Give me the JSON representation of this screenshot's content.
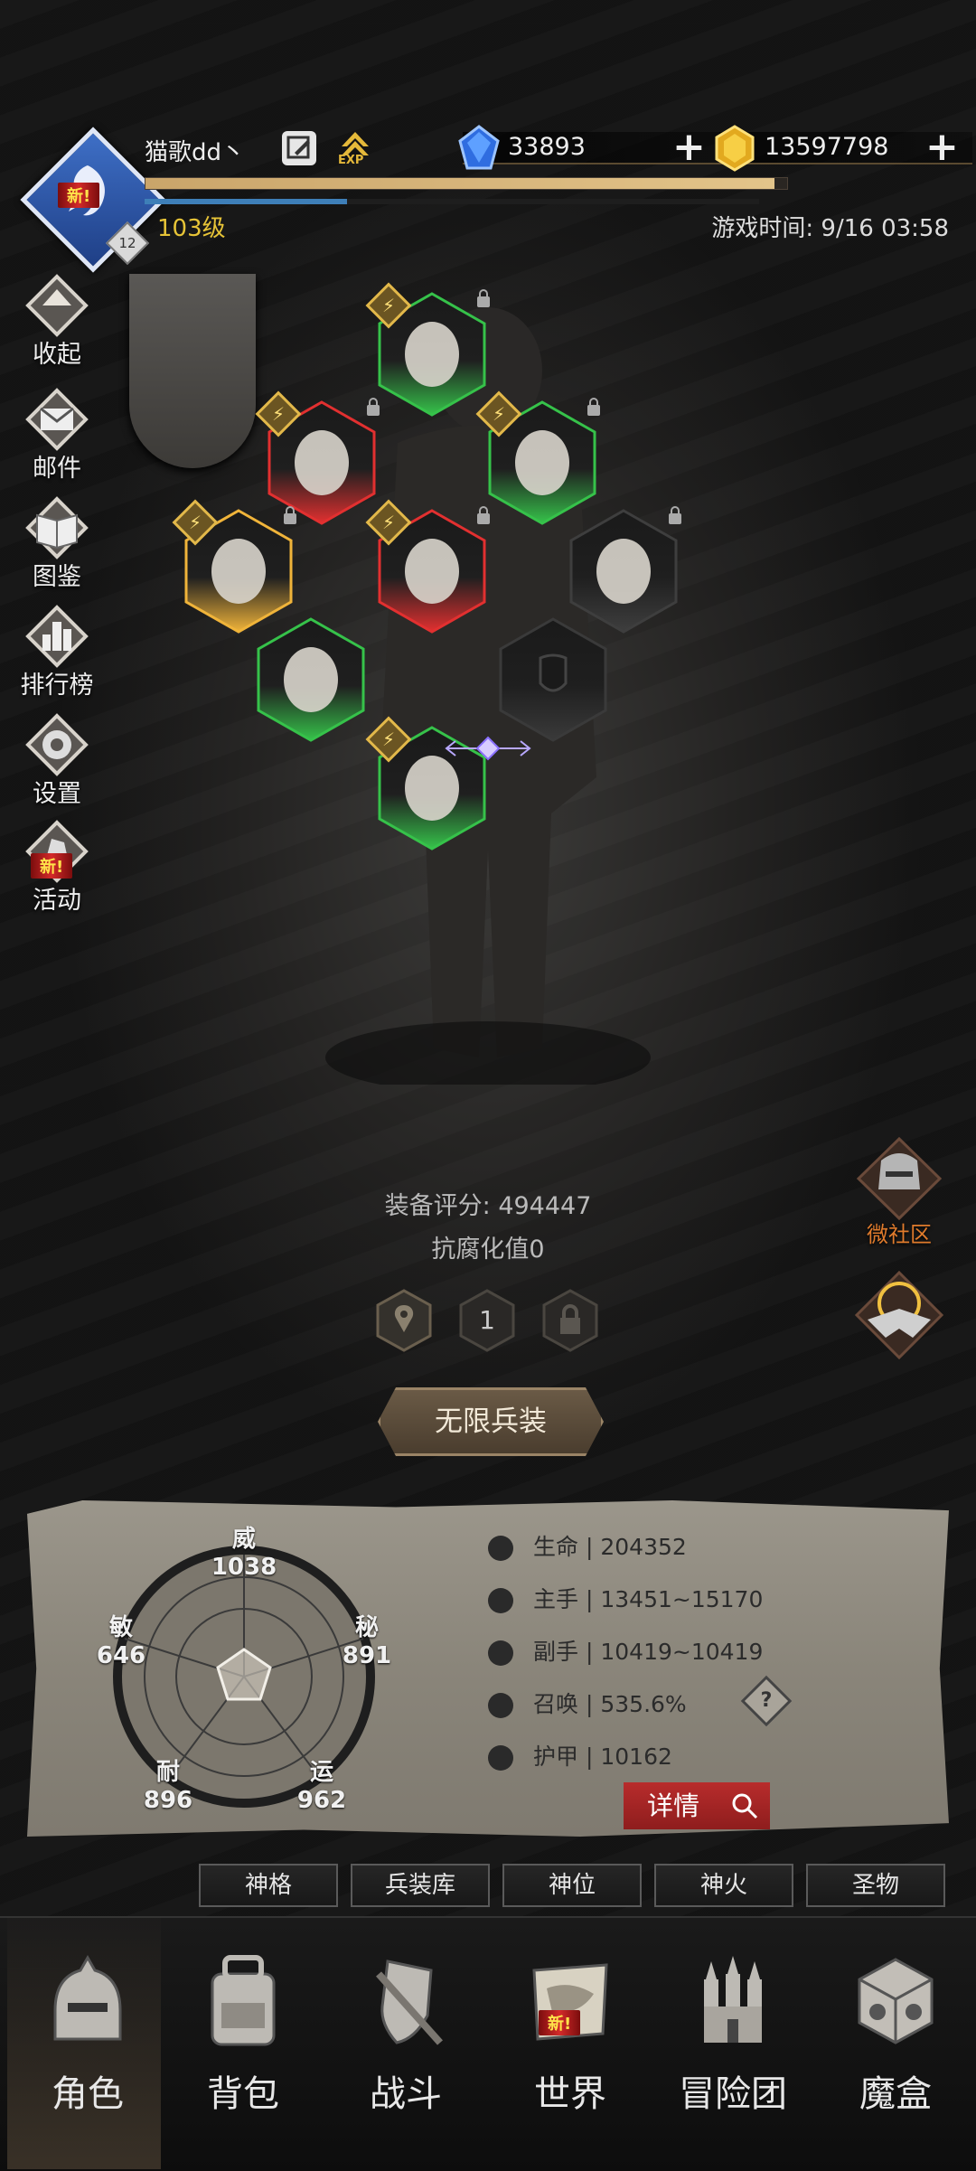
{
  "header": {
    "player_name": "猫歌dd丶",
    "exp_label": "EXP",
    "level_text": "103级",
    "vip_level": "12",
    "avatar_badge": "新!",
    "game_time_label": "游戏时间: ",
    "game_time_value": "9/16 03:58",
    "exp_progress": 0.98,
    "sub_progress": 0.33,
    "diamonds": "33893",
    "gold": "13597798"
  },
  "left_menu": [
    {
      "label": "收起",
      "icon": "collapse-icon"
    },
    {
      "label": "邮件",
      "icon": "mail-icon"
    },
    {
      "label": "图鉴",
      "icon": "book-icon"
    },
    {
      "label": "排行榜",
      "icon": "ranking-icon"
    },
    {
      "label": "设置",
      "icon": "gear-icon"
    },
    {
      "label": "活动",
      "icon": "event-icon",
      "badge": "新!"
    }
  ],
  "equipment": {
    "center_slot_count": "1",
    "slots": [
      {
        "name": "helmet",
        "rarity": "green"
      },
      {
        "name": "pauldron",
        "rarity": "red"
      },
      {
        "name": "amulet",
        "rarity": "green"
      },
      {
        "name": "belt",
        "rarity": "gold"
      },
      {
        "name": "armor",
        "rarity": "red"
      },
      {
        "name": "cloak",
        "rarity": "dark"
      },
      {
        "name": "weapon",
        "rarity": "green"
      },
      {
        "name": "shield",
        "rarity": "empty"
      },
      {
        "name": "boots",
        "rarity": "green"
      }
    ]
  },
  "stats_summary": {
    "score_label": "装备评分:",
    "score_value": "494447",
    "anti_corruption": "抗腐化值0",
    "slot_number": "1",
    "infinite_button": "无限兵装"
  },
  "right_buttons": {
    "community": "微社区"
  },
  "attributes": {
    "wei": {
      "name": "威",
      "value": "1038"
    },
    "mi": {
      "name": "秘",
      "value": "891"
    },
    "yun": {
      "name": "运",
      "value": "962"
    },
    "nai": {
      "name": "耐",
      "value": "896"
    },
    "min": {
      "name": "敏",
      "value": "646"
    }
  },
  "stats": [
    {
      "label": "生命",
      "value": "204352",
      "icon": "heart-icon"
    },
    {
      "label": "主手",
      "value": "13451~15170",
      "icon": "sword-icon"
    },
    {
      "label": "副手",
      "value": "10419~10419",
      "icon": "offhand-icon"
    },
    {
      "label": "召唤",
      "value": "535.6%",
      "icon": "summon-icon"
    },
    {
      "label": "护甲",
      "value": "10162",
      "icon": "armor-icon"
    }
  ],
  "separator": "|",
  "help_icon": "?",
  "detail_button": "详情",
  "tabs": [
    "神格",
    "兵装库",
    "神位",
    "神火",
    "圣物"
  ],
  "bottom_nav": [
    {
      "label": "角色",
      "icon": "helmet-icon",
      "active": true
    },
    {
      "label": "背包",
      "icon": "backpack-icon"
    },
    {
      "label": "战斗",
      "icon": "battle-icon"
    },
    {
      "label": "世界",
      "icon": "world-map-icon",
      "badge": "新!"
    },
    {
      "label": "冒险团",
      "icon": "castle-icon"
    },
    {
      "label": "魔盒",
      "icon": "cube-icon"
    }
  ]
}
